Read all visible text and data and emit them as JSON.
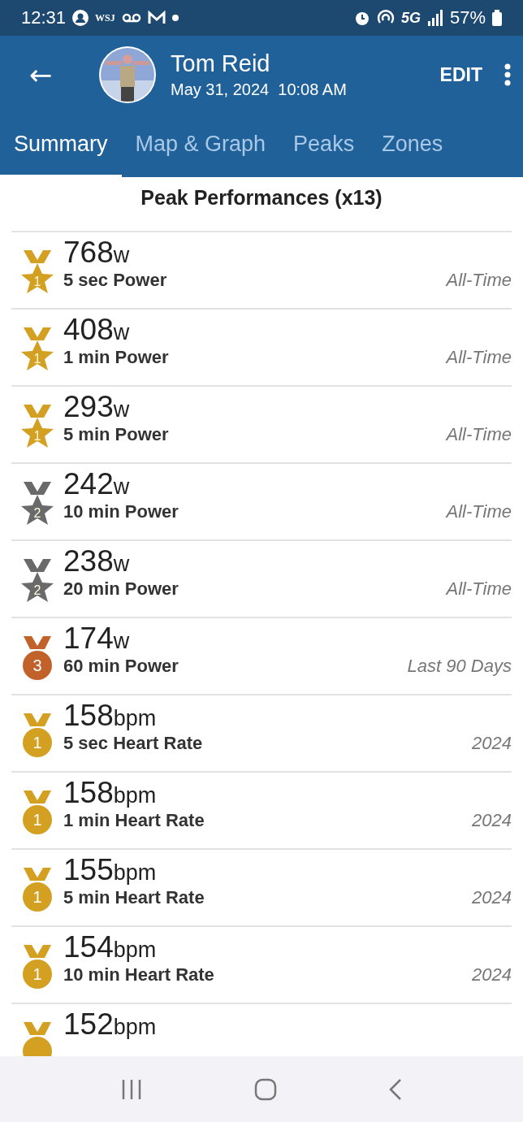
{
  "status_bar": {
    "time": "12:31",
    "app_badge": "WSJ",
    "network": "5G",
    "battery": "57%"
  },
  "header": {
    "back": "←",
    "name": "Tom Reid",
    "datetime": "May 31, 2024  10:08 AM",
    "action": "EDIT"
  },
  "tabs": [
    {
      "label": "Summary",
      "selected": true
    },
    {
      "label": "Map & Graph",
      "selected": false
    },
    {
      "label": "Peaks",
      "selected": false
    },
    {
      "label": "Zones",
      "selected": false
    }
  ],
  "section_title": "Peak Performances (x13)",
  "peaks": [
    {
      "kind": "star",
      "color": "#d4a022",
      "rank": "1",
      "value": "768",
      "unit": "w",
      "label": "5 sec Power",
      "period": "All-Time"
    },
    {
      "kind": "star",
      "color": "#d4a022",
      "rank": "1",
      "value": "408",
      "unit": "w",
      "label": "1 min Power",
      "period": "All-Time"
    },
    {
      "kind": "star",
      "color": "#d4a022",
      "rank": "1",
      "value": "293",
      "unit": "w",
      "label": "5 min Power",
      "period": "All-Time"
    },
    {
      "kind": "star",
      "color": "#6a6a6a",
      "rank": "2",
      "value": "242",
      "unit": "w",
      "label": "10 min Power",
      "period": "All-Time"
    },
    {
      "kind": "star",
      "color": "#6a6a6a",
      "rank": "2",
      "value": "238",
      "unit": "w",
      "label": "20 min Power",
      "period": "All-Time"
    },
    {
      "kind": "round",
      "color": "#c0622a",
      "rank": "3",
      "value": "174",
      "unit": "w",
      "label": "60 min Power",
      "period": "Last 90 Days"
    },
    {
      "kind": "round",
      "color": "#d4a022",
      "rank": "1",
      "value": "158",
      "unit": "bpm",
      "label": "5 sec Heart Rate",
      "period": "2024"
    },
    {
      "kind": "round",
      "color": "#d4a022",
      "rank": "1",
      "value": "158",
      "unit": "bpm",
      "label": "1 min Heart Rate",
      "period": "2024"
    },
    {
      "kind": "round",
      "color": "#d4a022",
      "rank": "1",
      "value": "155",
      "unit": "bpm",
      "label": "5 min Heart Rate",
      "period": "2024"
    },
    {
      "kind": "round",
      "color": "#d4a022",
      "rank": "1",
      "value": "154",
      "unit": "bpm",
      "label": "10 min Heart Rate",
      "period": "2024"
    },
    {
      "kind": "round",
      "color": "#d4a022",
      "value": "152",
      "unit": "bpm"
    }
  ]
}
